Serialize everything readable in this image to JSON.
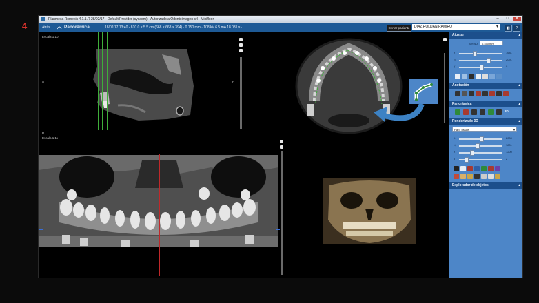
{
  "figure_number": "4",
  "window": {
    "title": "Planmeca Romexis 4.1.1.R  28/02/17 - Default Provider (cycadm) - Autorizado a Odontoimagen srl - Minifloor",
    "controls": [
      "–",
      "□",
      "✕"
    ]
  },
  "toolbar": {
    "back_label": "Atrás",
    "mode_label": "Panorámica",
    "info": "18/02/17 13:40 - 810.0 × 5.5 cm (668 × 668 × 394) · 0.150 mm · 108 kV 6.5 mA 18.031 s ·",
    "close_patient_label": "Cerrar paciente",
    "patient_name": "DIAZ ROLDAN RAMIRO"
  },
  "views": {
    "sagittal_scale": "Escala 1:10",
    "panoramic_scale": "Escala 1:11",
    "orient_a": "A",
    "orient_p": "P",
    "r_marker": "R"
  },
  "sidebar": {
    "ajustar": {
      "title": "Ajustar",
      "sensor_label": "Sensor",
      "sensor_value": "0,450 mm",
      "sliders": [
        {
          "icon": "contrast-icon",
          "value": 1681
        },
        {
          "icon": "brightness-icon",
          "value": 2091
        },
        {
          "icon": "gamma-icon",
          "value": 0
        }
      ]
    },
    "anotacion": {
      "title": "Anotación"
    },
    "panoramica": {
      "title": "Panorámica",
      "badge": "3D"
    },
    "renderizado": {
      "title": "Renderizado 3D",
      "preset": "Hard Tissue",
      "sliders": [
        2000,
        1801,
        1200,
        2
      ]
    },
    "explorador": {
      "title": "Explorador de objetos"
    }
  },
  "colors": {
    "toolbar": "#1e5a96",
    "sidebar": "#4d86c8",
    "section_header": "#1c4f8c",
    "figure_number": "#d8322c",
    "arrow": "#3d82c4"
  }
}
